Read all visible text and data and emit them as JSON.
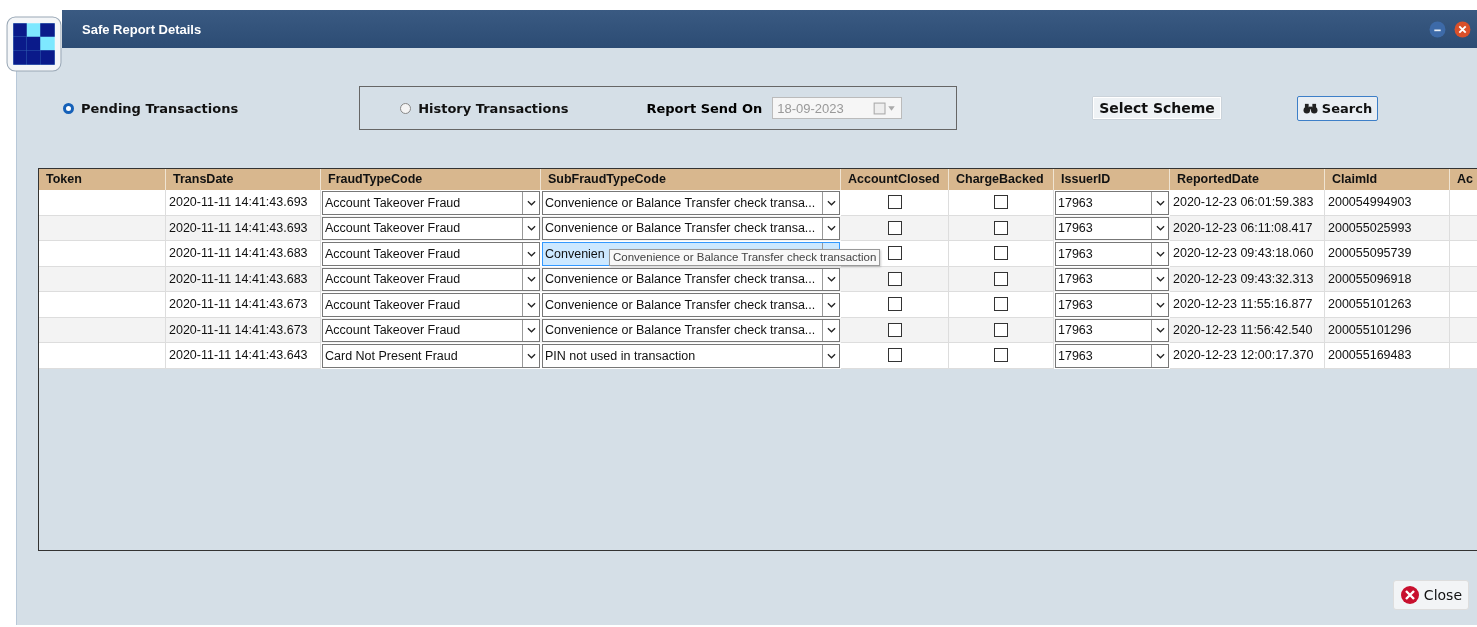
{
  "window": {
    "title": "Safe Report Details"
  },
  "filters": {
    "radios": [
      {
        "label": "Pending Transactions",
        "selected": true
      },
      {
        "label": "History Transactions",
        "selected": false
      }
    ],
    "report_send_on": {
      "label": "Report Send On",
      "value": "18-09-2023",
      "disabled": true
    },
    "buttons": [
      {
        "kind": "plain",
        "label": "Select Scheme"
      },
      {
        "kind": "search",
        "label": "Search"
      }
    ]
  },
  "table": {
    "columns": [
      "Token",
      "TransDate",
      "FraudTypeCode",
      "SubFraudTypeCode",
      "AccountClosed",
      "ChargeBacked",
      "IssuerID",
      "ReportedDate",
      "ClaimId",
      "Ac"
    ],
    "rows": [
      {
        "selected": false,
        "trans_date": "2020-11-11 14:41:43.693",
        "fraud_type": "Account Takeover Fraud",
        "sub_fraud_type": "Convenience or Balance Transfer check transa...",
        "account_closed": false,
        "charge_backed": false,
        "issuer_id": "17963",
        "reported_date": "2020-12-23 06:01:59.383",
        "claim_id": "200054994903"
      },
      {
        "selected": false,
        "trans_date": "2020-11-11 14:41:43.693",
        "fraud_type": "Account Takeover Fraud",
        "sub_fraud_type": "Convenience or Balance Transfer check transa...",
        "account_closed": false,
        "charge_backed": false,
        "issuer_id": "17963",
        "reported_date": "2020-12-23 06:11:08.417",
        "claim_id": "200055025993"
      },
      {
        "selected": true,
        "trans_date": "2020-11-11 14:41:43.683",
        "fraud_type": "Account Takeover Fraud",
        "sub_fraud_type": "Convenien",
        "account_closed": false,
        "charge_backed": false,
        "issuer_id": "17963",
        "reported_date": "2020-12-23 09:43:18.060",
        "claim_id": "200055095739"
      },
      {
        "selected": false,
        "trans_date": "2020-11-11 14:41:43.683",
        "fraud_type": "Account Takeover Fraud",
        "sub_fraud_type": "Convenience or Balance Transfer check transa...",
        "account_closed": false,
        "charge_backed": false,
        "issuer_id": "17963",
        "reported_date": "2020-12-23 09:43:32.313",
        "claim_id": "200055096918"
      },
      {
        "selected": false,
        "trans_date": "2020-11-11 14:41:43.673",
        "fraud_type": "Account Takeover Fraud",
        "sub_fraud_type": "Convenience or Balance Transfer check transa...",
        "account_closed": false,
        "charge_backed": false,
        "issuer_id": "17963",
        "reported_date": "2020-12-23 11:55:16.877",
        "claim_id": "200055101263"
      },
      {
        "selected": false,
        "trans_date": "2020-11-11 14:41:43.673",
        "fraud_type": "Account Takeover Fraud",
        "sub_fraud_type": "Convenience or Balance Transfer check transa...",
        "account_closed": false,
        "charge_backed": false,
        "issuer_id": "17963",
        "reported_date": "2020-12-23 11:56:42.540",
        "claim_id": "200055101296"
      },
      {
        "selected": false,
        "trans_date": "2020-11-11 14:41:43.643",
        "fraud_type": "Card Not Present Fraud",
        "sub_fraud_type": "PIN not used in transaction",
        "account_closed": false,
        "charge_backed": false,
        "issuer_id": "17963",
        "reported_date": "2020-12-23 12:00:17.370",
        "claim_id": "200055169483"
      }
    ],
    "tooltip": "Convenience or Balance Transfer check transaction"
  },
  "footer": {
    "close_button": "Close"
  }
}
